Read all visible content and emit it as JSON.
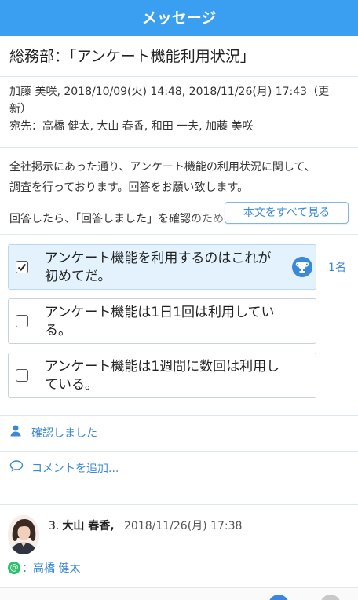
{
  "header": {
    "title": "メッセージ"
  },
  "subject": "総務部：「アンケート機能利用状況」",
  "meta": {
    "line1": "加藤 美咲, 2018/10/09(火) 14:48, 2018/11/26(月) 17:43（更",
    "line2": "新）",
    "recipients": "宛先：高橋 健太, 大山 春香, 和田 一夫, 加藤 美咲"
  },
  "body": {
    "line1": "全社掲示にあった通り、アンケート機能の利用状況に関して、",
    "line2": "調査を行っております。回答をお願い致します。",
    "line3": "回答したら、「回答しました」を確認のためクリックしてくださ",
    "more_label": "本文をすべて見る"
  },
  "survey": {
    "options": [
      {
        "label": "アンケート機能を利用するのはこれが初めてだ。",
        "checked": true
      },
      {
        "label": "アンケート機能は1日1回は利用している。",
        "checked": false
      },
      {
        "label": "アンケート機能は1週間に数回は利用している。",
        "checked": false
      }
    ],
    "vote_count": "1名",
    "accent": "#3a89d8"
  },
  "actions": {
    "confirmed": "確認しました",
    "add_comment": "コメントを追加..."
  },
  "comment": {
    "number": "3.",
    "author": "大山 春香,",
    "timestamp": "2018/11/26(月) 17:38",
    "mention": "：高橋 健太"
  },
  "icons": {
    "checkbox": "checkbox-checked-icon",
    "trophy": "trophy-icon",
    "person": "person-icon",
    "comment": "comment-bubble-icon",
    "mention": "at-mention-icon"
  }
}
